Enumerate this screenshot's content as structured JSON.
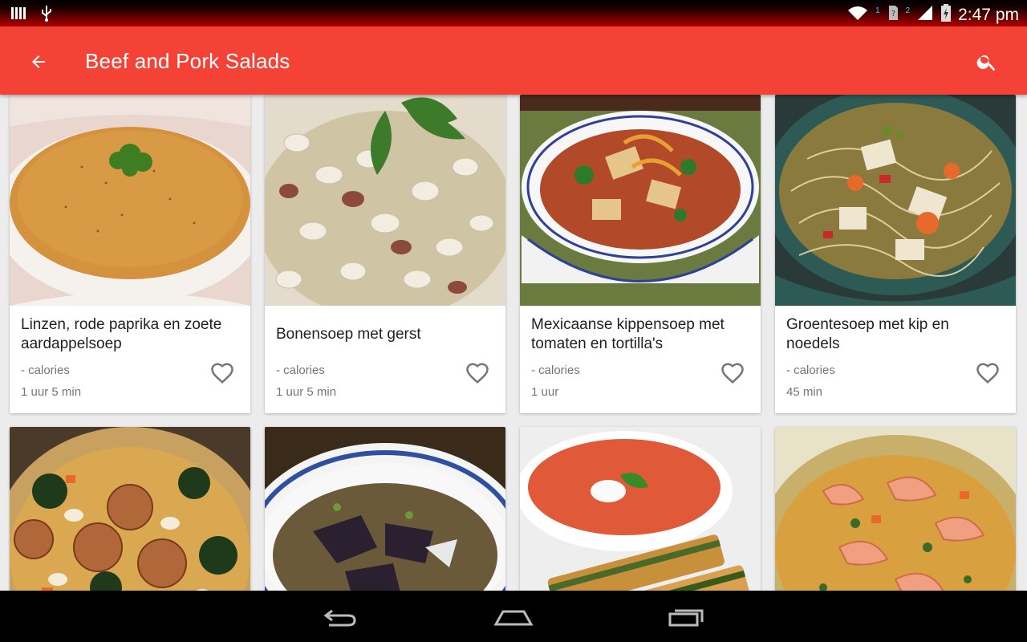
{
  "status_bar": {
    "time": "2:47 pm",
    "sim1_label": "1",
    "sim2_label": "2"
  },
  "app_bar": {
    "title": "Beef and Pork Salads",
    "back_icon": "arrow-back-icon",
    "search_icon": "search-icon"
  },
  "colors": {
    "primary": "#f44336",
    "card_bg": "#ffffff",
    "background": "#ececec"
  },
  "recipes": [
    {
      "name": "Linzen, rode paprika en zoete aardappelsoep",
      "calories": "- calories",
      "time": "1 uur 5 min",
      "image": "orange lentil soup in white bowl with parsley"
    },
    {
      "name": "Bonensoep met gerst",
      "calories": "- calories",
      "time": "1 uur 5 min",
      "image": "white bean and barley soup with basil"
    },
    {
      "name": "Mexicaanse kippensoep met tomaten en tortilla's",
      "calories": "- calories",
      "time": "1 uur",
      "image": "mexican chicken tortilla soup in blue-rimmed bowl"
    },
    {
      "name": "Groentesoep met kip en noedels",
      "calories": "- calories",
      "time": "45 min",
      "image": "chicken noodle vegetable soup in teal bowl"
    },
    {
      "name": "",
      "calories": "",
      "time": "",
      "image": "sausage, kale and bean soup"
    },
    {
      "name": "",
      "calories": "",
      "time": "",
      "image": "clear soup with greens in blue-striped bowl"
    },
    {
      "name": "",
      "calories": "",
      "time": "",
      "image": "tomato soup with cream and toasted bread"
    },
    {
      "name": "",
      "calories": "",
      "time": "",
      "image": "shrimp vegetable soup"
    }
  ],
  "nav_bar": {
    "back": "nav-back-icon",
    "home": "nav-home-icon",
    "recents": "nav-recents-icon"
  }
}
